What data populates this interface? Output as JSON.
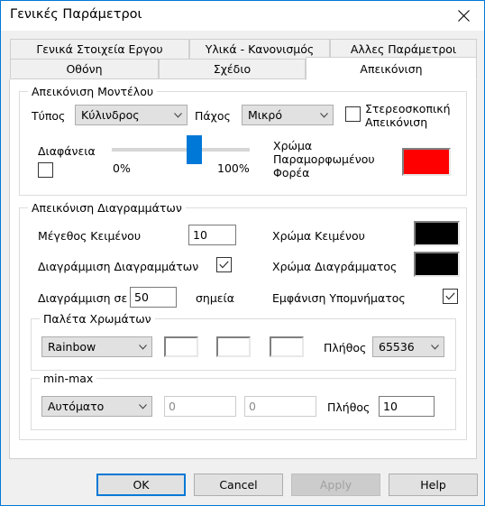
{
  "window": {
    "title": "Γενικές Παράμετροι",
    "close_icon": "close-icon"
  },
  "tabs": {
    "row1": [
      {
        "label": "Γενικά Στοιχεία Εργου",
        "selected": false
      },
      {
        "label": "Υλικά - Κανονισμός",
        "selected": false
      },
      {
        "label": "Αλλες Παράμετροι",
        "selected": false
      }
    ],
    "row2": [
      {
        "label": "Οθόνη",
        "selected": false
      },
      {
        "label": "Σχέδιο",
        "selected": false
      },
      {
        "label": "Απεικόνιση",
        "selected": true
      }
    ]
  },
  "model_group": {
    "legend": "Απεικόνιση Μοντέλου",
    "type_label": "Τύπος",
    "type_value": "Κύλινδρος",
    "thickness_label": "Πάχος",
    "thickness_value": "Μικρό",
    "stereo_label": "Στερεοσκοπική Απεικόνιση",
    "stereo_checked": false,
    "transparency_label": "Διαφάνεια",
    "transparency_checked": false,
    "slider_min_label": "0%",
    "slider_max_label": "100%",
    "slider_value": 50,
    "deformed_color_label": "Χρώμα Παραμορφωμένου Φορέα",
    "deformed_color": "#ff0000"
  },
  "diagram_group": {
    "legend": "Απεικόνιση Διαγραμμάτων",
    "text_size_label": "Μέγεθος Κειμένου",
    "text_size_value": "10",
    "text_color_label": "Χρώμα Κειμένου",
    "text_color": "#000000",
    "hatch_label": "Διαγράμμιση Διαγραμμάτων",
    "hatch_checked": true,
    "diagram_color_label": "Χρώμα Διαγράμματος",
    "diagram_color": "#000000",
    "hatch_at_label": "Διαγράμμιση σε",
    "hatch_at_value": "50",
    "points_label": "σημεία",
    "legend_show_label": "Εμφάνιση Υπομνήματος",
    "legend_show_checked": true
  },
  "palette_group": {
    "legend": "Παλέτα Χρωμάτων",
    "palette_value": "Rainbow",
    "color1": "#ffffff",
    "color2": "#ffffff",
    "color3": "#ffffff",
    "count_label": "Πλήθος",
    "count_value": "65536"
  },
  "minmax_group": {
    "legend": "min-max",
    "mode_value": "Αυτόματο",
    "min_value": "0",
    "max_value": "0",
    "count_label": "Πλήθος",
    "count_value": "10"
  },
  "buttons": {
    "ok": "OK",
    "cancel": "Cancel",
    "apply": "Apply",
    "help": "Help"
  }
}
